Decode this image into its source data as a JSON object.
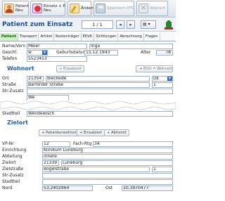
{
  "toolbar": {
    "new_patient": "Patient\nNeu",
    "new_deployment": "Einsatz + P.\nNeu",
    "change": "Ändern",
    "save": "Speichern (F5)",
    "cancel": "Abbruch"
  },
  "header": {
    "title": "Patient zum Einsatz",
    "pager": "1 / 1",
    "prev": "◂",
    "next": "▸",
    "menu": "▤ ▾"
  },
  "tabs": [
    "Patient",
    "Transport",
    "Artikel",
    "Kostenträger",
    "EKVK",
    "Sichtungen",
    "Abrechnung",
    "Fragen"
  ],
  "patient": {
    "name_label": "Name/Vorn",
    "last_name": "Meier",
    "first_name": "Inga",
    "gender_label": "Geschl.",
    "gender": "w",
    "birthdate_label": "Geburtsdatum",
    "birthdate": "15.12.1943",
    "age_label": "Alter",
    "age": "78",
    "phone_label": "Telefon",
    "phone": "5523453"
  },
  "wohnort": {
    "title": "Wohnort",
    "btn_einsatzort": "+ Einsatzort",
    "btn_eort_wohnort": "EOrt = Wohnort",
    "ort_label": "Ort",
    "plz": "21354",
    "ort": "Bleckede",
    "country": "DE",
    "strasse_label": "Straße",
    "strasse": "Barförder Straße",
    "hausnr": "1",
    "strzusatz_label": "Str-Zusatz",
    "strzusatz": "",
    "stadtteil_partial": "We",
    "stadtteil_label": "Stadtteil",
    "stadtteil": "Wendewisch"
  },
  "zielort": {
    "title": "Zielort",
    "btn_patientenwohnort": "+ Patientenwohnort",
    "btn_einsatzort": "+ Einsatzort",
    "btn_abholort": "+ Abholort",
    "vpnr_label": "VP-Nr",
    "vpnr": "12",
    "fachrtg_label": "Fach-Rtg",
    "fachrtg": "34",
    "einrichtung_label": "Einrichtung",
    "einrichtung": "Klinikum Lüneburg",
    "abteilung_label": "Abteilung",
    "abteilung": "innere",
    "zielort_label": "Zielort",
    "plz": "21339",
    "ort": "Lüneburg",
    "zielstrasse_label": "Zielstraße",
    "zielstrasse": "Bögelstraße",
    "hausnr": "1",
    "strzusatz_label": "Str-Zusatz",
    "strzusatz": "",
    "stadtteil_label": "Stadtteil",
    "stadtteil": "",
    "nord_label": "Nord",
    "nord": "53,2402964",
    "ost_label": "Ost",
    "ost": "10,3970477"
  }
}
